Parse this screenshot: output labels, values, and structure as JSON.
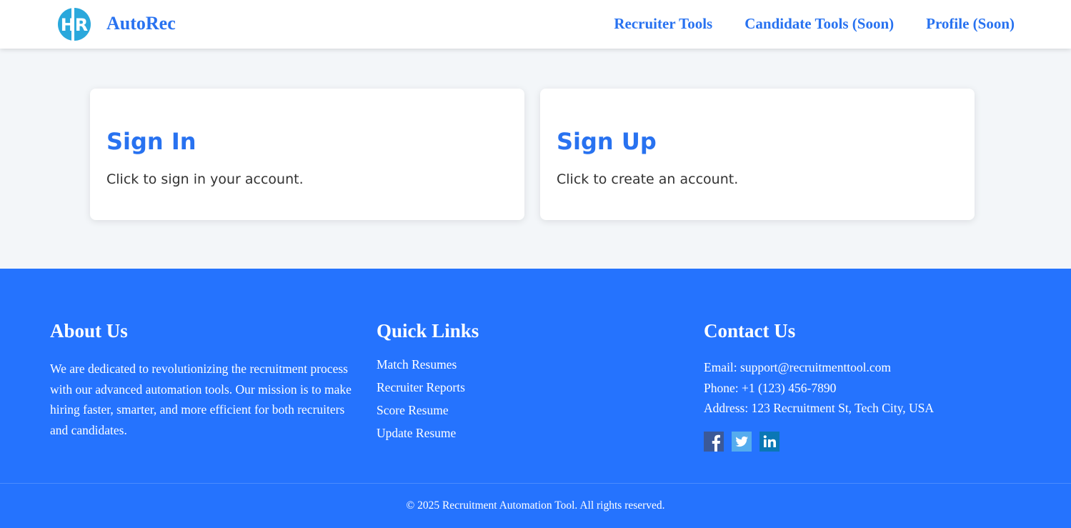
{
  "header": {
    "logo_text": "HR",
    "brand": "AutoRec",
    "nav": [
      {
        "label": "Recruiter Tools"
      },
      {
        "label": "Candidate Tools (Soon)"
      },
      {
        "label": "Profile (Soon)"
      }
    ]
  },
  "cards": {
    "signin": {
      "title": "Sign In",
      "text": "Click to sign in your account."
    },
    "signup": {
      "title": "Sign Up",
      "text": "Click to create an account."
    }
  },
  "footer": {
    "about": {
      "title": "About Us",
      "text": "We are dedicated to revolutionizing the recruitment process with our advanced automation tools. Our mission is to make hiring faster, smarter, and more efficient for both recruiters and candidates."
    },
    "links": {
      "title": "Quick Links",
      "items": [
        "Match Resumes",
        "Recruiter Reports",
        "Score Resume",
        "Update Resume"
      ]
    },
    "contact": {
      "title": "Contact Us",
      "email": "Email: support@recruitmenttool.com",
      "phone": "Phone: +1 (123) 456-7890",
      "address": "Address: 123 Recruitment St, Tech City, USA",
      "social": [
        "facebook-icon",
        "twitter-icon",
        "linkedin-icon"
      ]
    },
    "copyright": "© 2025 Recruitment Automation Tool. All rights reserved."
  },
  "colors": {
    "accent": "#2872f0",
    "footer_bg": "#2573fe",
    "page_bg": "#f3f6f9",
    "logo": "#2aa8dc",
    "facebook": "#3b5998",
    "twitter": "#55acee",
    "linkedin": "#0a77b5"
  }
}
